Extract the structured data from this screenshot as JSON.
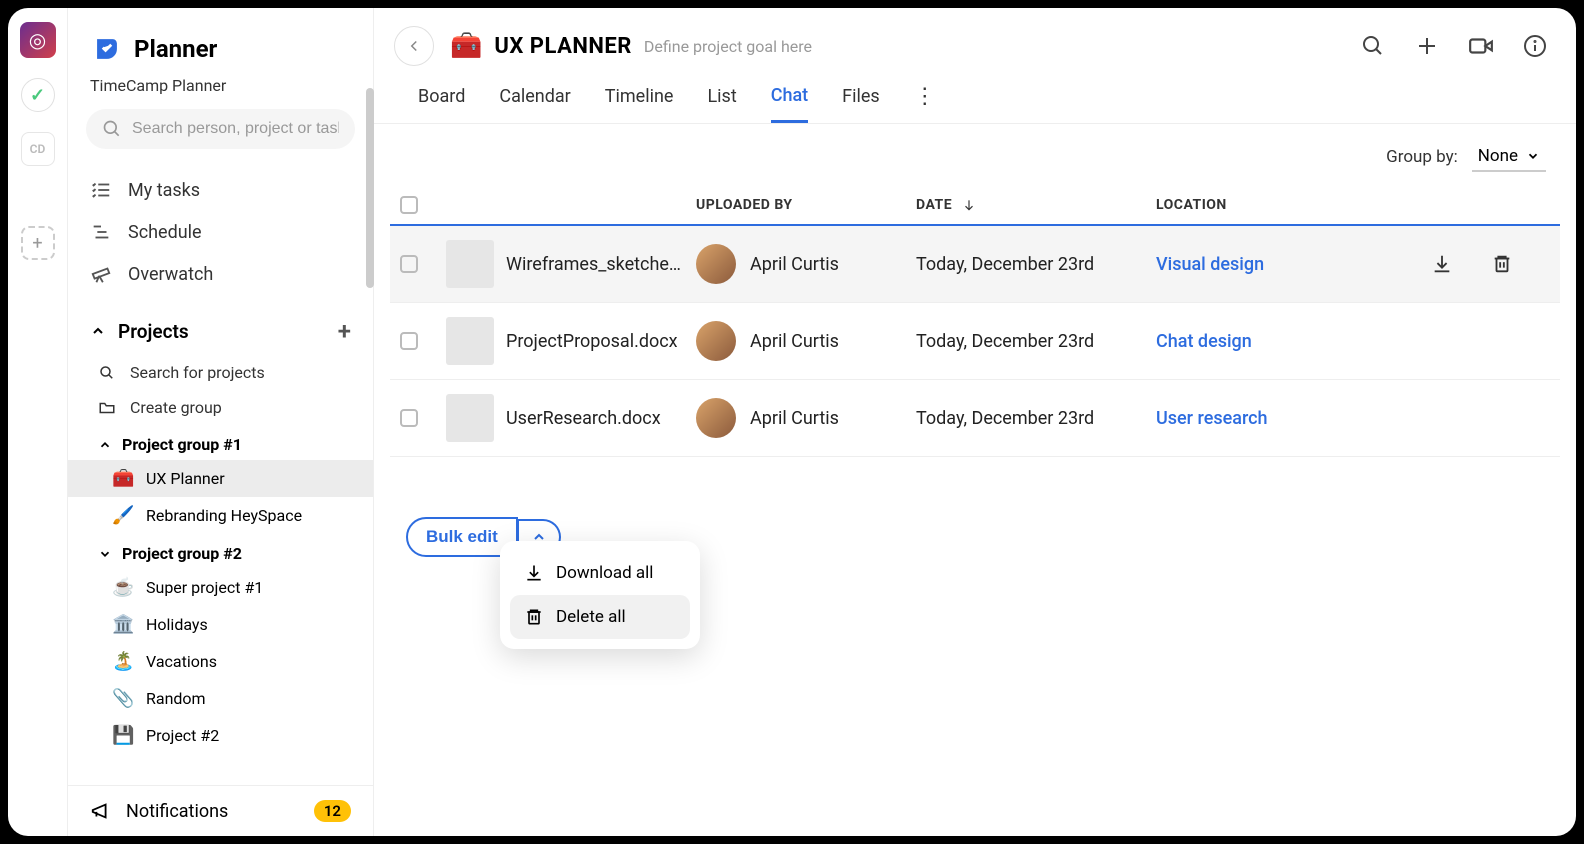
{
  "rail": {
    "cd_label": "CD"
  },
  "brand": {
    "title": "Planner",
    "subtitle": "TimeCamp Planner"
  },
  "search": {
    "placeholder": "Search person, project or task"
  },
  "nav": {
    "my_tasks": "My tasks",
    "schedule": "Schedule",
    "overwatch": "Overwatch"
  },
  "projects": {
    "header": "Projects",
    "search": "Search for projects",
    "create_group": "Create group",
    "group1": {
      "name": "Project group #1",
      "items": [
        {
          "label": "UX Planner",
          "icon": "🧰"
        },
        {
          "label": "Rebranding HeySpace",
          "icon": "🖌️"
        }
      ]
    },
    "group2": {
      "name": "Project group #2",
      "items": [
        {
          "label": "Super project #1",
          "icon": "☕"
        },
        {
          "label": "Holidays",
          "icon": "🏛️"
        },
        {
          "label": "Vacations",
          "icon": "🏝️"
        },
        {
          "label": "Random",
          "icon": "📎"
        },
        {
          "label": "Project #2",
          "icon": "💾"
        }
      ]
    }
  },
  "notifications": {
    "label": "Notifications",
    "count": "12"
  },
  "header": {
    "title": "UX PLANNER",
    "goal_placeholder": "Define project goal here"
  },
  "tabs": [
    "Board",
    "Calendar",
    "Timeline",
    "List",
    "Chat",
    "Files"
  ],
  "active_tab": "Chat",
  "groupby": {
    "label": "Group by:",
    "value": "None"
  },
  "columns": {
    "uploaded_by": "UPLOADED BY",
    "date": "DATE",
    "location": "LOCATION"
  },
  "rows": [
    {
      "file": "Wireframes_sketche…",
      "uploader": "April Curtis",
      "date": "Today, December 23rd",
      "location": "Visual design"
    },
    {
      "file": "ProjectProposal.docx",
      "uploader": "April Curtis",
      "date": "Today, December 23rd",
      "location": "Chat design"
    },
    {
      "file": "UserResearch.docx",
      "uploader": "April Curtis",
      "date": "Today, December 23rd",
      "location": "User research"
    }
  ],
  "bulk": {
    "label": "Bulk edit",
    "download_all": "Download all",
    "delete_all": "Delete all"
  }
}
